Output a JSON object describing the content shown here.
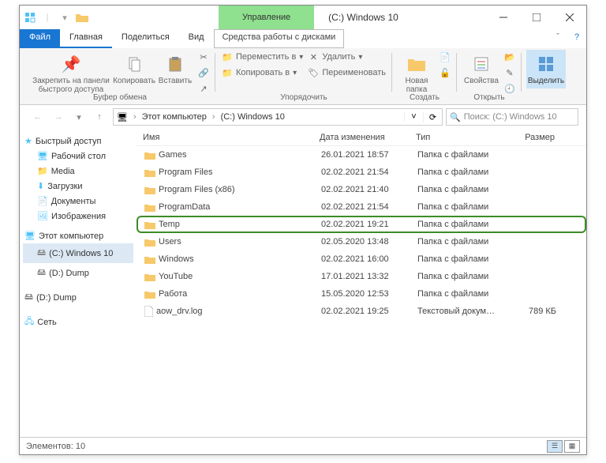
{
  "title": {
    "management": "Управление",
    "text": "(C:) Windows 10"
  },
  "menu": {
    "file": "Файл",
    "home": "Главная",
    "share": "Поделиться",
    "view": "Вид",
    "tools": "Средства работы с дисками"
  },
  "ribbon": {
    "pin": "Закрепить на панели быстрого доступа",
    "copy": "Копировать",
    "paste": "Вставить",
    "clipboard": "Буфер обмена",
    "moveTo": "Переместить в",
    "copyTo": "Копировать в",
    "delete": "Удалить",
    "rename": "Переименовать",
    "organize": "Упорядочить",
    "newFolder": "Новая папка",
    "create": "Создать",
    "properties": "Свойства",
    "open": "Открыть",
    "select": "Выделить"
  },
  "breadcrumb": {
    "thisPC": "Этот компьютер",
    "drive": "(C:) Windows 10"
  },
  "search": {
    "placeholder": "Поиск: (C:) Windows 10"
  },
  "nav": {
    "quick": "Быстрый доступ",
    "desktop": "Рабочий стол",
    "media": "Media",
    "downloads": "Загрузки",
    "documents": "Документы",
    "pictures": "Изображения",
    "thisPC": "Этот компьютер",
    "c": "(C:) Windows 10",
    "d": "(D:) Dump",
    "d2": "(D:) Dump",
    "network": "Сеть"
  },
  "cols": {
    "name": "Имя",
    "date": "Дата изменения",
    "type": "Тип",
    "size": "Размер"
  },
  "rows": [
    {
      "name": "Games",
      "date": "26.01.2021 18:57",
      "type": "Папка с файлами",
      "size": "",
      "icon": "folder"
    },
    {
      "name": "Program Files",
      "date": "02.02.2021 21:54",
      "type": "Папка с файлами",
      "size": "",
      "icon": "folder"
    },
    {
      "name": "Program Files (x86)",
      "date": "02.02.2021 21:40",
      "type": "Папка с файлами",
      "size": "",
      "icon": "folder"
    },
    {
      "name": "ProgramData",
      "date": "02.02.2021 21:54",
      "type": "Папка с файлами",
      "size": "",
      "icon": "folder"
    },
    {
      "name": "Temp",
      "date": "02.02.2021 19:21",
      "type": "Папка с файлами",
      "size": "",
      "icon": "folder",
      "highlight": true
    },
    {
      "name": "Users",
      "date": "02.05.2020 13:48",
      "type": "Папка с файлами",
      "size": "",
      "icon": "folder"
    },
    {
      "name": "Windows",
      "date": "02.02.2021 16:00",
      "type": "Папка с файлами",
      "size": "",
      "icon": "folder"
    },
    {
      "name": "YouTube",
      "date": "17.01.2021 13:32",
      "type": "Папка с файлами",
      "size": "",
      "icon": "folder"
    },
    {
      "name": "Работа",
      "date": "15.05.2020 12:53",
      "type": "Папка с файлами",
      "size": "",
      "icon": "folder"
    },
    {
      "name": "aow_drv.log",
      "date": "02.02.2021 19:25",
      "type": "Текстовый докум…",
      "size": "789 КБ",
      "icon": "file"
    }
  ],
  "status": {
    "count": "Элементов: 10"
  }
}
